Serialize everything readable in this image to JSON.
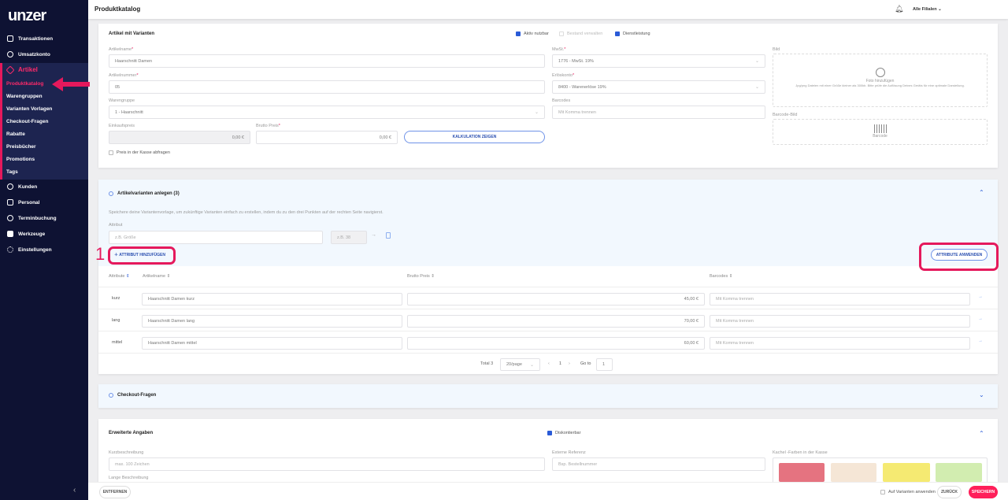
{
  "sidebar": {
    "logo": "unzer",
    "items": [
      {
        "label": "Transaktionen",
        "icon": "transactions-icon"
      },
      {
        "label": "Umsatzkonto",
        "icon": "user-icon"
      },
      {
        "label": "Artikel",
        "icon": "tag-icon"
      }
    ],
    "artikel_sub": [
      "Produktkatalog",
      "Warengruppen",
      "Varianten Vorlagen",
      "Checkout-Fragen",
      "Rabatte",
      "Preisbücher",
      "Promotions",
      "Tags"
    ],
    "items2": [
      {
        "label": "Kunden",
        "icon": "people-icon"
      },
      {
        "label": "Personal",
        "icon": "id-card-icon"
      },
      {
        "label": "Terminbuchung",
        "icon": "clock-icon"
      },
      {
        "label": "Werkzeuge",
        "icon": "folder-icon"
      },
      {
        "label": "Einstellungen",
        "icon": "gear-icon"
      }
    ],
    "collapse": "‹"
  },
  "header": {
    "title": "Produktkatalog",
    "store": "Alle Filialen"
  },
  "article": {
    "title": "Artikel mit Varianten",
    "aktiv": "Aktiv nutzbar",
    "bestand": "Bestand verwalten",
    "dienst": "Dienstleistung",
    "name_label": "Artikelname",
    "name": "Haarschnitt Damen",
    "nr_label": "Artikelnummer",
    "nr": "05",
    "group_label": "Warengruppe",
    "group": "1 - Haarschnitt",
    "ek_label": "Einkaufspreis",
    "ek": "0,00 €",
    "brutto_label": "Brutto Preis",
    "brutto": "0,00 €",
    "kalk": "KALKULATION ZEIGEN",
    "kasse": "Preis in der Kasse abfragen",
    "mwst_label": "MwSt.",
    "mwst": "1776 - MwSt. 19%",
    "erl_label": "Erlöskonto",
    "erl": "8400 - Warenerlöse 19%",
    "bc_label": "Barcodes",
    "bc_ph": "Mit Komma trennen",
    "bild_label": "Bild",
    "foto": "Foto hinzufügen",
    "foto_hint": "Jpg/png Dateien mit einer Größe kleiner als 300kb. Bitte prüfe die Auflösung Deines Geräts für eine optimale Darstellung.",
    "bcbild_label": "Barcode-Bild",
    "barcode": "Barcode",
    "req": "*"
  },
  "variants": {
    "title": "Artikelvarianten anlegen (3)",
    "desc": "Speichere deine Variantenvorlage, um zukünftige Varianten einfach zu erstellen, indem du zu den drei Punkten auf der rechten Seite navigierst.",
    "attr_label": "Attribut",
    "attr_ph": "z.B. Größe",
    "val_ph": "z.B. 38",
    "add": "ATTRIBUT HINZUFÜGEN",
    "apply": "ATTRIBUTE ANWENDEN",
    "annot": "1",
    "cols": [
      "Attribute",
      "Artikelname",
      "Brutto Preis",
      "Barcodes"
    ],
    "rows": [
      {
        "attr": "kurz",
        "name": "Haarschnitt Damen kurz",
        "price": "45,00 €",
        "bc": "Mit Komma trennen"
      },
      {
        "attr": "lang",
        "name": "Haarschnitt Damen lang",
        "price": "70,00 €",
        "bc": "Mit Komma trennen"
      },
      {
        "attr": "mittel",
        "name": "Haarschnitt Damen mittel",
        "price": "60,00 €",
        "bc": "Mit Komma trennen"
      }
    ],
    "total": "Total 3",
    "perpage": "20/page",
    "page": "1",
    "goto": "Go to",
    "goto_val": "1"
  },
  "checkout": {
    "title": "Checkout-Fragen"
  },
  "extended": {
    "title": "Erweiterte Angaben",
    "disk": "Diskontierbar",
    "kurz_label": "Kurzbeschreibung",
    "kurz_ph": "max. 100 Zeichen",
    "lang_label": "Lange Beschreibung",
    "ext_label": "Externe Referenz",
    "ext_ph": "Bsp. Bestellnummer",
    "kachel_label": "Kachel -Farben in der Kasse",
    "colors": [
      "#e57380",
      "#f5e6d6",
      "#f5ea72",
      "#d2edb0"
    ]
  },
  "footer": {
    "remove": "ENTFERNEN",
    "apply_variants": "Auf Varianten anwenden",
    "back": "ZURÜCK",
    "save": "SPEICHERN"
  }
}
